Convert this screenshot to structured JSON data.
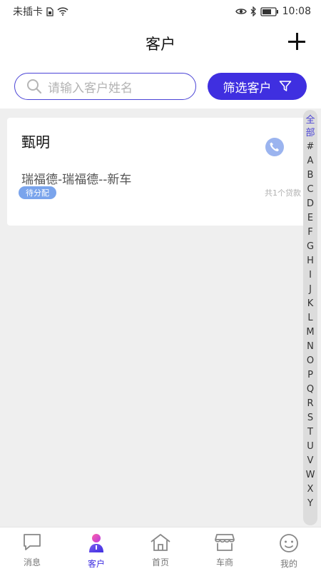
{
  "status_bar": {
    "carrier": "未插卡",
    "time": "10:08"
  },
  "header": {
    "title": "客户",
    "add_icon": "plus-icon"
  },
  "search": {
    "placeholder": "请输入客户姓名",
    "filter_label": "筛选客户"
  },
  "customers": [
    {
      "name": "甄明",
      "detail": "瑞福德-瑞福德--新车",
      "tag": "待分配",
      "loan_count": "共1个贷款"
    }
  ],
  "alpha_index": [
    "全",
    "部",
    "#",
    "A",
    "B",
    "C",
    "D",
    "E",
    "F",
    "G",
    "H",
    "I",
    "J",
    "K",
    "L",
    "M",
    "N",
    "O",
    "P",
    "Q",
    "R",
    "S",
    "T",
    "U",
    "V",
    "W",
    "X",
    "Y"
  ],
  "tabs": [
    {
      "label": "消息",
      "icon": "message-icon"
    },
    {
      "label": "客户",
      "icon": "customer-icon",
      "active": true
    },
    {
      "label": "首页",
      "icon": "home-icon"
    },
    {
      "label": "车商",
      "icon": "store-icon"
    },
    {
      "label": "我的",
      "icon": "profile-icon"
    }
  ],
  "colors": {
    "accent": "#3f2fe0",
    "tag_bg": "#7aa4ec",
    "phone_bg": "#9bb4ef"
  }
}
